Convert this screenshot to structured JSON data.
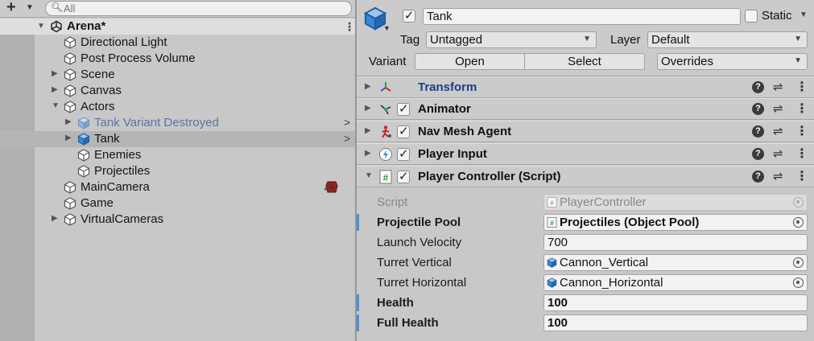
{
  "hierarchy": {
    "search_placeholder": "All",
    "scene": {
      "name": "Arena*"
    },
    "items": [
      {
        "label": "Directional Light",
        "name": "directional-light"
      },
      {
        "label": "Post Process Volume",
        "name": "post-process-volume"
      },
      {
        "label": "Scene",
        "name": "scene"
      },
      {
        "label": "Canvas",
        "name": "canvas"
      },
      {
        "label": "Actors",
        "name": "actors"
      },
      {
        "label": "Tank Variant Destroyed",
        "name": "tank-variant-destroyed"
      },
      {
        "label": "Tank",
        "name": "tank"
      },
      {
        "label": "Enemies",
        "name": "enemies"
      },
      {
        "label": "Projectiles",
        "name": "projectiles"
      },
      {
        "label": "MainCamera",
        "name": "main-camera"
      },
      {
        "label": "Game",
        "name": "game"
      },
      {
        "label": "VirtualCameras",
        "name": "virtual-cameras"
      }
    ]
  },
  "inspector": {
    "object_name": "Tank",
    "static_label": "Static",
    "tag_label": "Tag",
    "tag_value": "Untagged",
    "layer_label": "Layer",
    "layer_value": "Default",
    "variant_label": "Variant",
    "open_label": "Open",
    "select_label": "Select",
    "overrides_label": "Overrides",
    "components": [
      {
        "name": "Transform"
      },
      {
        "name": "Animator"
      },
      {
        "name": "Nav Mesh Agent"
      },
      {
        "name": "Player Input"
      },
      {
        "name": "Player Controller (Script)"
      }
    ],
    "properties": [
      {
        "label": "Script",
        "value": "PlayerController"
      },
      {
        "label": "Projectile Pool",
        "value": "Projectiles (Object Pool)"
      },
      {
        "label": "Launch Velocity",
        "value": "700"
      },
      {
        "label": "Turret Vertical",
        "value": "Cannon_Vertical"
      },
      {
        "label": "Turret Horizontal",
        "value": "Cannon_Horizontal"
      },
      {
        "label": "Health",
        "value": "100"
      },
      {
        "label": "Full Health",
        "value": "100"
      }
    ]
  },
  "colors": {
    "selection": "#b5b5b5",
    "prefab_text": "#5b73a5",
    "link_text": "#1d3f87",
    "modified_bar": "#4a8fd8"
  }
}
